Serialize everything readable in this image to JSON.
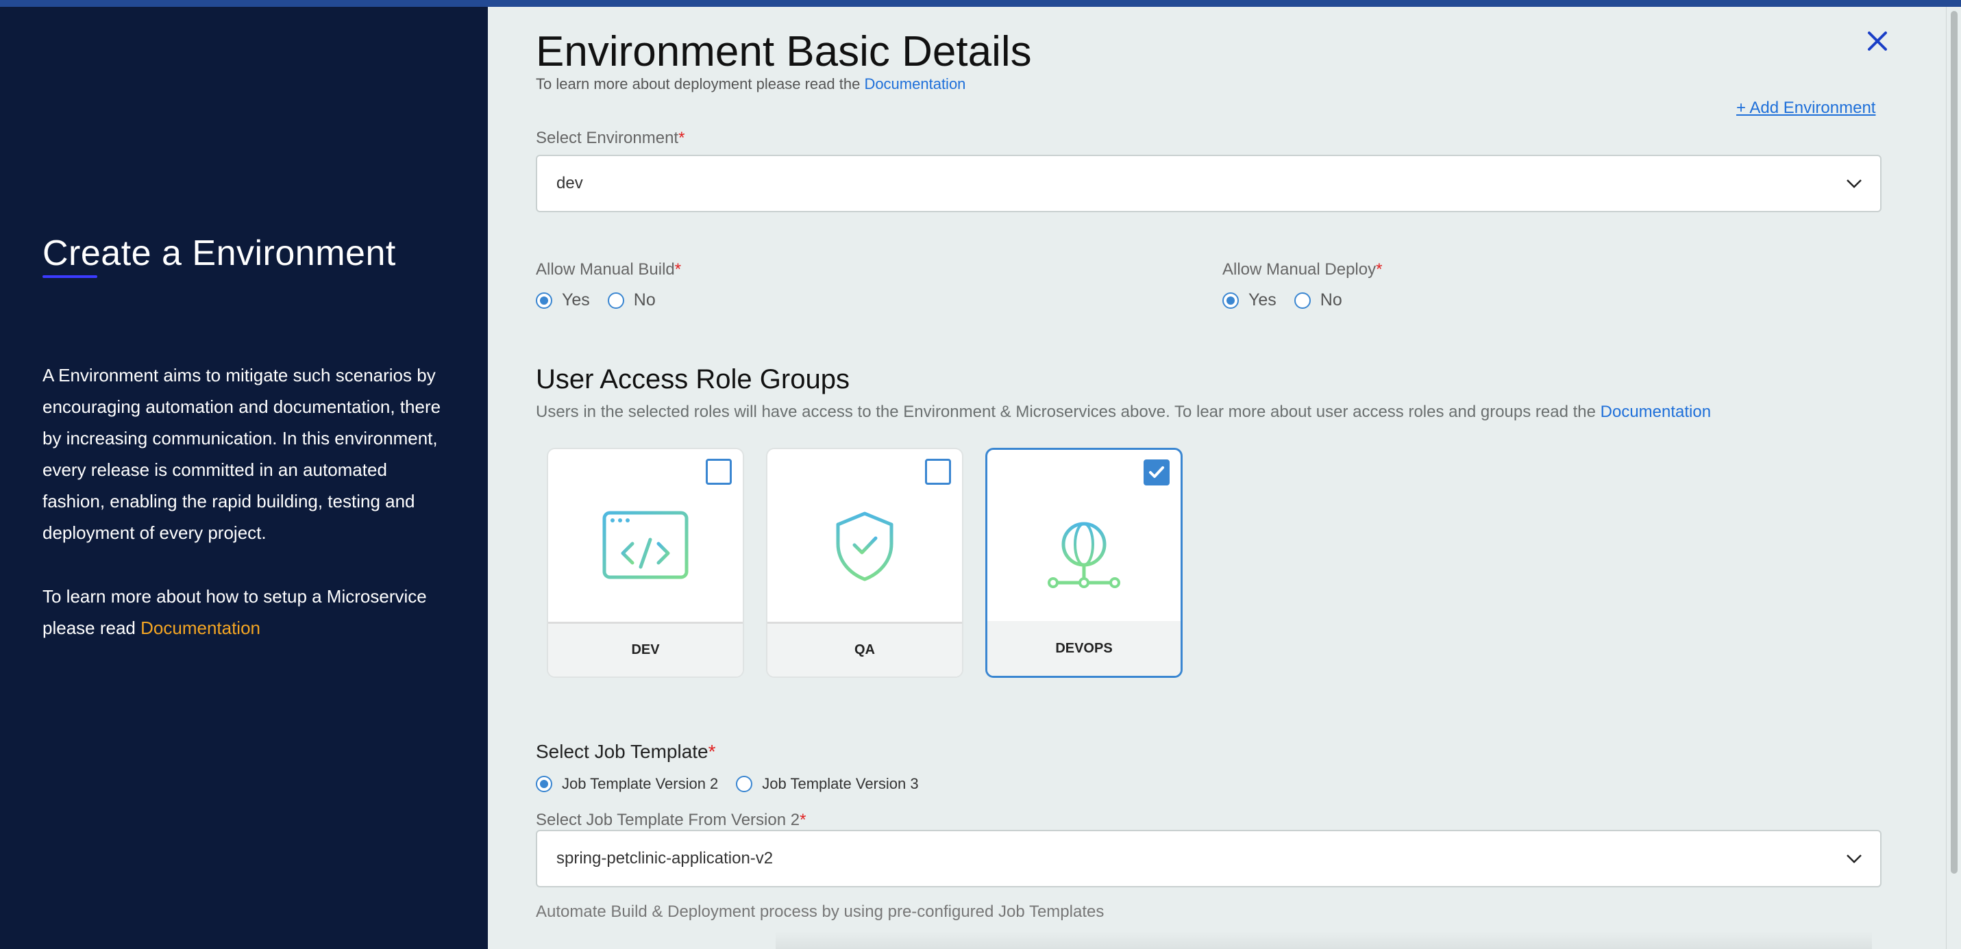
{
  "left_panel": {
    "title": "Create a Environment",
    "description": "A Environment aims to mitigate such scenarios by encouraging automation and documentation, there by increasing communication. In this environment, every release is committed in an automated fashion, enabling the rapid building, testing and deployment of every project.",
    "learn_prefix": "To learn more about how to setup a Microservice please read",
    "learn_link": "Documentation"
  },
  "header": {
    "title": "Environment Basic Details",
    "subtitle_prefix": "To learn more about deployment please read the",
    "subtitle_link": "Documentation",
    "add_environment": "+ Add Environment"
  },
  "environment": {
    "label": "Select Environment",
    "required_mark": "*",
    "value": "dev"
  },
  "manual_build": {
    "label": "Allow Manual Build",
    "required_mark": "*",
    "options": [
      "Yes",
      "No"
    ],
    "selected": "Yes"
  },
  "manual_deploy": {
    "label": "Allow Manual Deploy",
    "required_mark": "*",
    "options": [
      "Yes",
      "No"
    ],
    "selected": "Yes"
  },
  "role_groups": {
    "title": "User Access Role Groups",
    "description": "Users in the selected roles will have access to the Environment & Microservices above. To lear more about user access roles and groups read the",
    "description_link": "Documentation",
    "cards": [
      {
        "label": "DEV",
        "icon": "code-window-icon",
        "checked": false
      },
      {
        "label": "QA",
        "icon": "shield-check-icon",
        "checked": false
      },
      {
        "label": "DEVOPS",
        "icon": "globe-network-icon",
        "checked": true
      }
    ]
  },
  "job_template": {
    "label": "Select Job Template",
    "required_mark": "*",
    "options": [
      "Job Template Version 2",
      "Job Template Version 3"
    ],
    "selected": "Job Template Version 2",
    "from_label": "Select Job Template From Version 2",
    "from_required_mark": "*",
    "value": "spring-petclinic-application-v2",
    "helper": "Automate Build & Deployment process by using pre-configured Job Templates"
  },
  "colors": {
    "accent": "#3a86d1",
    "link": "#1e6fd9",
    "left_bg": "#0c1a3a",
    "right_bg": "#e8eeee",
    "required": "#e02020",
    "left_link": "#f5a623"
  }
}
